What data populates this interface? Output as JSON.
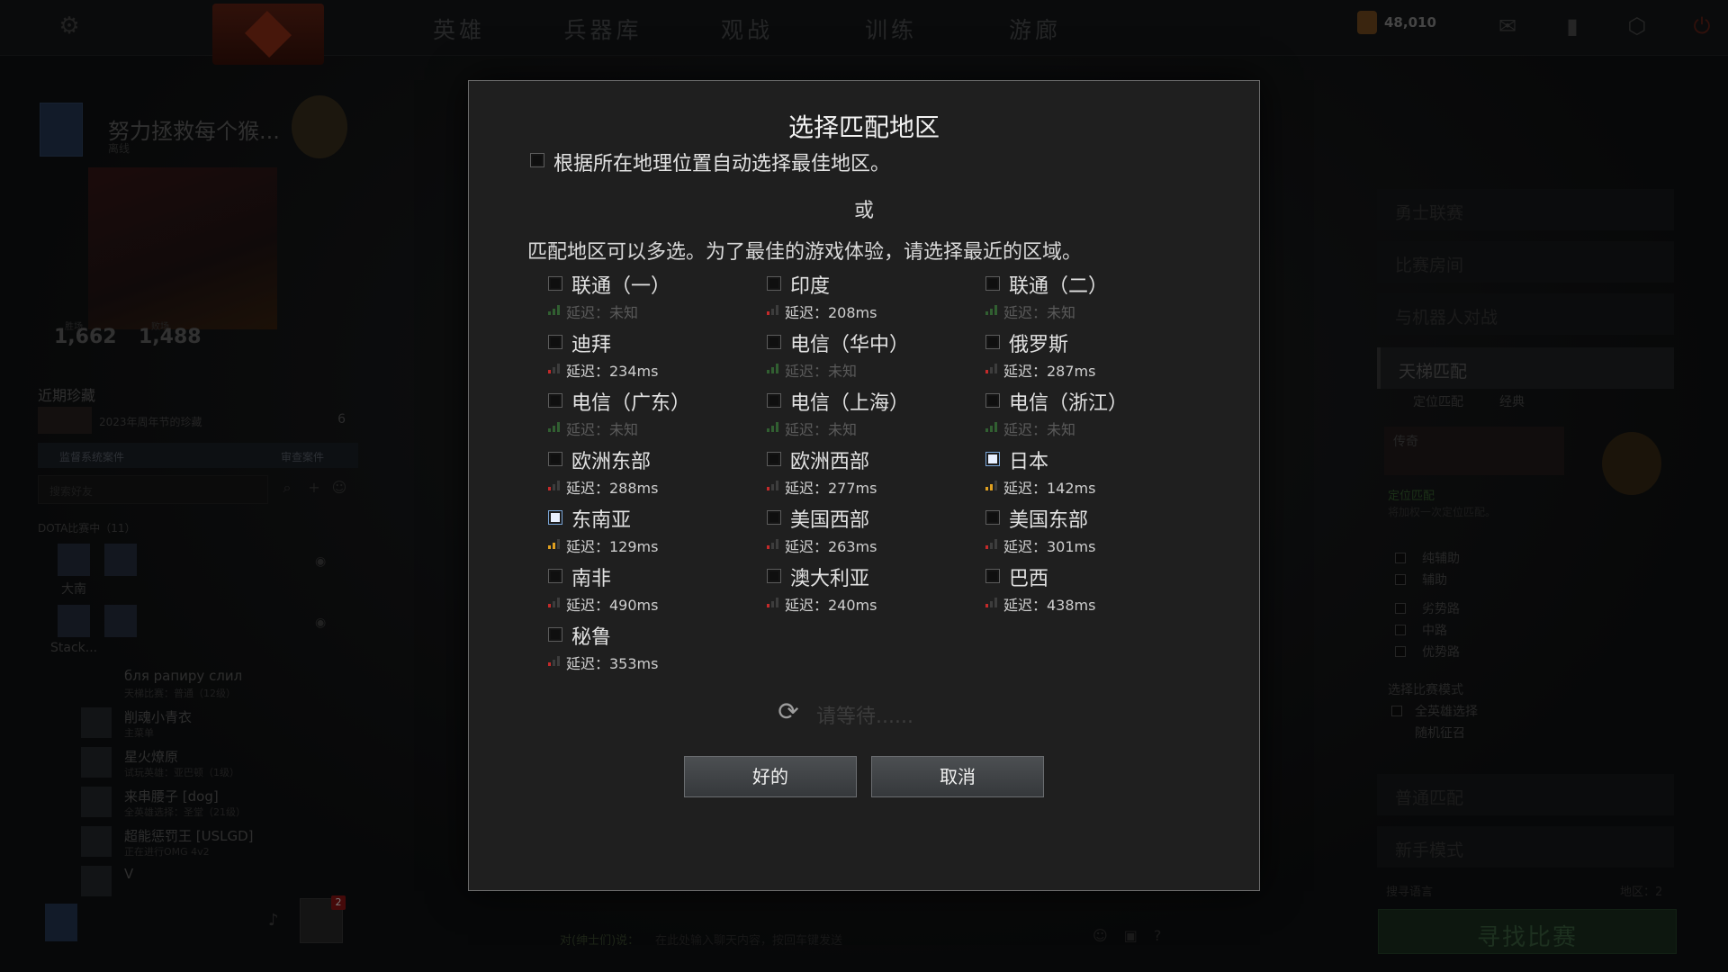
{
  "nav": {
    "items": [
      "英雄",
      "兵器库",
      "观战",
      "训练",
      "游廊"
    ]
  },
  "top": {
    "currency": "48,010"
  },
  "profile": {
    "name": "努力拯救每个猴...",
    "sub": "离线",
    "stat1_label": "胜场",
    "stat1": "1,662",
    "stat2_label": "败场",
    "stat2": "1,488"
  },
  "recent": {
    "title": "近期珍藏",
    "item": "2023年周年节的珍藏",
    "count": "6"
  },
  "case": {
    "label": "监督系统案件",
    "review": "审查案件"
  },
  "search": {
    "placeholder": "搜索好友"
  },
  "friends": {
    "header": "DOTA比赛中（11）",
    "party1_name": "大南",
    "party2_name": "Stack...",
    "rows": [
      {
        "name": "бля рапиру слил",
        "status": "天梯比赛：普通（12级）"
      },
      {
        "name": "削魂小青衣",
        "status": "主菜单"
      },
      {
        "name": "星火燎原",
        "status": "试玩英雄：亚巴顿（1级）"
      },
      {
        "name": "来串腰子 [dog]",
        "status": "全英雄选择：圣堂（21级）"
      },
      {
        "name": "超能惩罚王 [USLGD]",
        "status": "正在进行OMG 4v2"
      },
      {
        "name": "V",
        "status": ""
      }
    ],
    "notif_count": "2"
  },
  "right_panel": {
    "items": [
      "勇士联赛",
      "比赛房间",
      "与机器人对战"
    ],
    "ranked": "天梯匹配",
    "ranked_sub1": "定位匹配",
    "ranked_sub2": "经典",
    "legend_rank": "传奇",
    "calib_label": "定位匹配",
    "calib_desc": "将加权一次定位匹配。",
    "roles": [
      "纯辅助",
      "辅助",
      "劣势路",
      "中路",
      "优势路"
    ],
    "mode_title": "选择比赛模式",
    "modes": [
      "全英雄选择",
      "随机征召"
    ],
    "lower_items": [
      "普通匹配",
      "新手模式"
    ],
    "lang_label": "搜寻语言",
    "region_label": "地区：2",
    "find_match": "寻找比赛"
  },
  "chat": {
    "label": "对(绅士们)说：",
    "placeholder": "在此处输入聊天内容，按回车键发送"
  },
  "dialog": {
    "title": "选择匹配地区",
    "auto_select": "根据所在地理位置自动选择最佳地区。",
    "or": "或",
    "instructions": "匹配地区可以多选。为了最佳的游戏体验，请选择最近的区域。",
    "regions": [
      {
        "name": "联通（一）",
        "ping": "延迟：未知",
        "signal": "unknown",
        "checked": false
      },
      {
        "name": "印度",
        "ping": "延迟：208ms",
        "signal": "red",
        "checked": false
      },
      {
        "name": "联通（二）",
        "ping": "延迟：未知",
        "signal": "unknown",
        "checked": false
      },
      {
        "name": "迪拜",
        "ping": "延迟：234ms",
        "signal": "red",
        "checked": false
      },
      {
        "name": "电信（华中）",
        "ping": "延迟：未知",
        "signal": "unknown",
        "checked": false
      },
      {
        "name": "俄罗斯",
        "ping": "延迟：287ms",
        "signal": "red",
        "checked": false
      },
      {
        "name": "电信（广东）",
        "ping": "延迟：未知",
        "signal": "unknown",
        "checked": false
      },
      {
        "name": "电信（上海）",
        "ping": "延迟：未知",
        "signal": "unknown",
        "checked": false
      },
      {
        "name": "电信（浙江）",
        "ping": "延迟：未知",
        "signal": "unknown",
        "checked": false
      },
      {
        "name": "欧洲东部",
        "ping": "延迟：288ms",
        "signal": "red",
        "checked": false
      },
      {
        "name": "欧洲西部",
        "ping": "延迟：277ms",
        "signal": "red",
        "checked": false
      },
      {
        "name": "日本",
        "ping": "延迟：142ms",
        "signal": "orange",
        "checked": true
      },
      {
        "name": "东南亚",
        "ping": "延迟：129ms",
        "signal": "orange",
        "checked": true
      },
      {
        "name": "美国西部",
        "ping": "延迟：263ms",
        "signal": "red",
        "checked": false
      },
      {
        "name": "美国东部",
        "ping": "延迟：301ms",
        "signal": "red",
        "checked": false
      },
      {
        "name": "南非",
        "ping": "延迟：490ms",
        "signal": "red",
        "checked": false
      },
      {
        "name": "澳大利亚",
        "ping": "延迟：240ms",
        "signal": "red",
        "checked": false
      },
      {
        "name": "巴西",
        "ping": "延迟：438ms",
        "signal": "red",
        "checked": false
      },
      {
        "name": "秘鲁",
        "ping": "延迟：353ms",
        "signal": "red",
        "checked": false
      }
    ],
    "waiting": "请等待......",
    "ok": "好的",
    "cancel": "取消"
  }
}
